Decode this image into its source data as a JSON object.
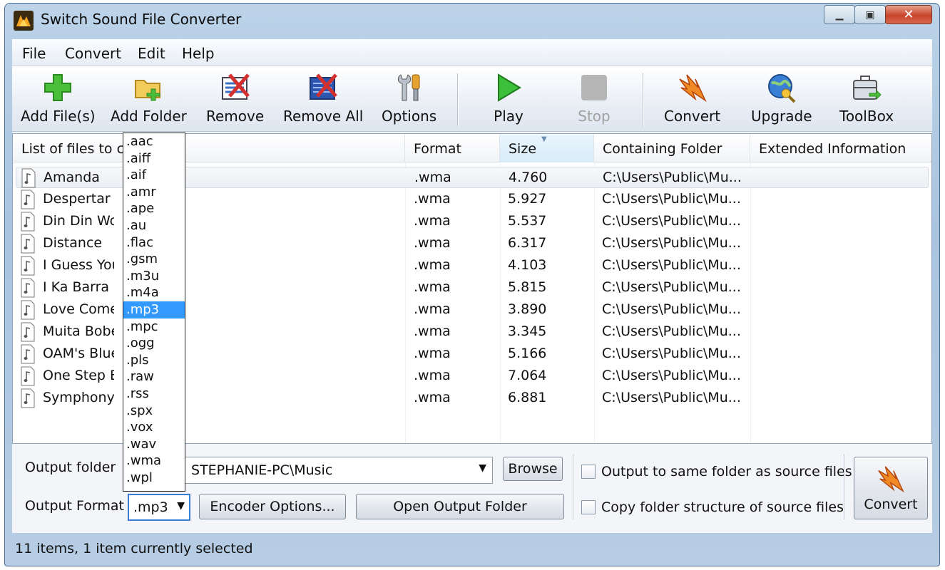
{
  "window": {
    "title": "Switch Sound File Converter"
  },
  "menu": [
    "File",
    "Convert",
    "Edit",
    "Help"
  ],
  "toolbar": {
    "add_files": "Add File(s)",
    "add_folder": "Add Folder",
    "remove": "Remove",
    "remove_all": "Remove All",
    "options": "Options",
    "play": "Play",
    "stop": "Stop",
    "convert": "Convert",
    "upgrade": "Upgrade",
    "toolbox": "ToolBox"
  },
  "list": {
    "columns": [
      "List of files to co",
      "Format",
      "Size",
      "Containing Folder",
      "Extended Information"
    ],
    "rows": [
      {
        "name": "Amanda",
        "format": ".wma",
        "size": "4.760",
        "folder": "C:\\Users\\Public\\Mu..."
      },
      {
        "name": "Despertar",
        "format": ".wma",
        "size": "5.927",
        "folder": "C:\\Users\\Public\\Mu..."
      },
      {
        "name": "Din Din Wo (",
        "format": ".wma",
        "size": "5.537",
        "folder": "C:\\Users\\Public\\Mu..."
      },
      {
        "name": "Distance",
        "format": ".wma",
        "size": "6.317",
        "folder": "C:\\Users\\Public\\Mu..."
      },
      {
        "name": "I Guess You'",
        "format": ".wma",
        "size": "4.103",
        "folder": "C:\\Users\\Public\\Mu..."
      },
      {
        "name": "I Ka Barra (Y",
        "format": ".wma",
        "size": "5.815",
        "folder": "C:\\Users\\Public\\Mu..."
      },
      {
        "name": "Love Comes",
        "format": ".wma",
        "size": "3.890",
        "folder": "C:\\Users\\Public\\Mu..."
      },
      {
        "name": "Muita Bobeira",
        "format": ".wma",
        "size": "3.345",
        "folder": "C:\\Users\\Public\\Mu..."
      },
      {
        "name": "OAM's Blues",
        "format": ".wma",
        "size": "5.166",
        "folder": "C:\\Users\\Public\\Mu..."
      },
      {
        "name": "One Step Be",
        "format": ".wma",
        "size": "7.064",
        "folder": "C:\\Users\\Public\\Mu..."
      },
      {
        "name": "Symphony_N",
        "format": ".wma",
        "size": "6.881",
        "folder": "C:\\Users\\Public\\Mu..."
      }
    ]
  },
  "bottom": {
    "output_folder_label": "Output folder",
    "output_folder_value": "STEPHANIE-PC\\Music",
    "browse": "Browse",
    "output_format_label": "Output Format",
    "output_format_value": ".mp3",
    "encoder_options": "Encoder Options...",
    "open_output_folder": "Open Output Folder",
    "same_folder": "Output to same folder as source files",
    "copy_structure": "Copy folder structure of source files",
    "convert": "Convert"
  },
  "dropdown_options": [
    ".aac",
    ".aiff",
    ".aif",
    ".amr",
    ".ape",
    ".au",
    ".flac",
    ".gsm",
    ".m3u",
    ".m4a",
    ".mp3",
    ".mpc",
    ".ogg",
    ".pls",
    ".raw",
    ".rss",
    ".spx",
    ".vox",
    ".wav",
    ".wma",
    ".wpl"
  ],
  "dropdown_selected": ".mp3",
  "status": "11 items, 1 item currently selected"
}
